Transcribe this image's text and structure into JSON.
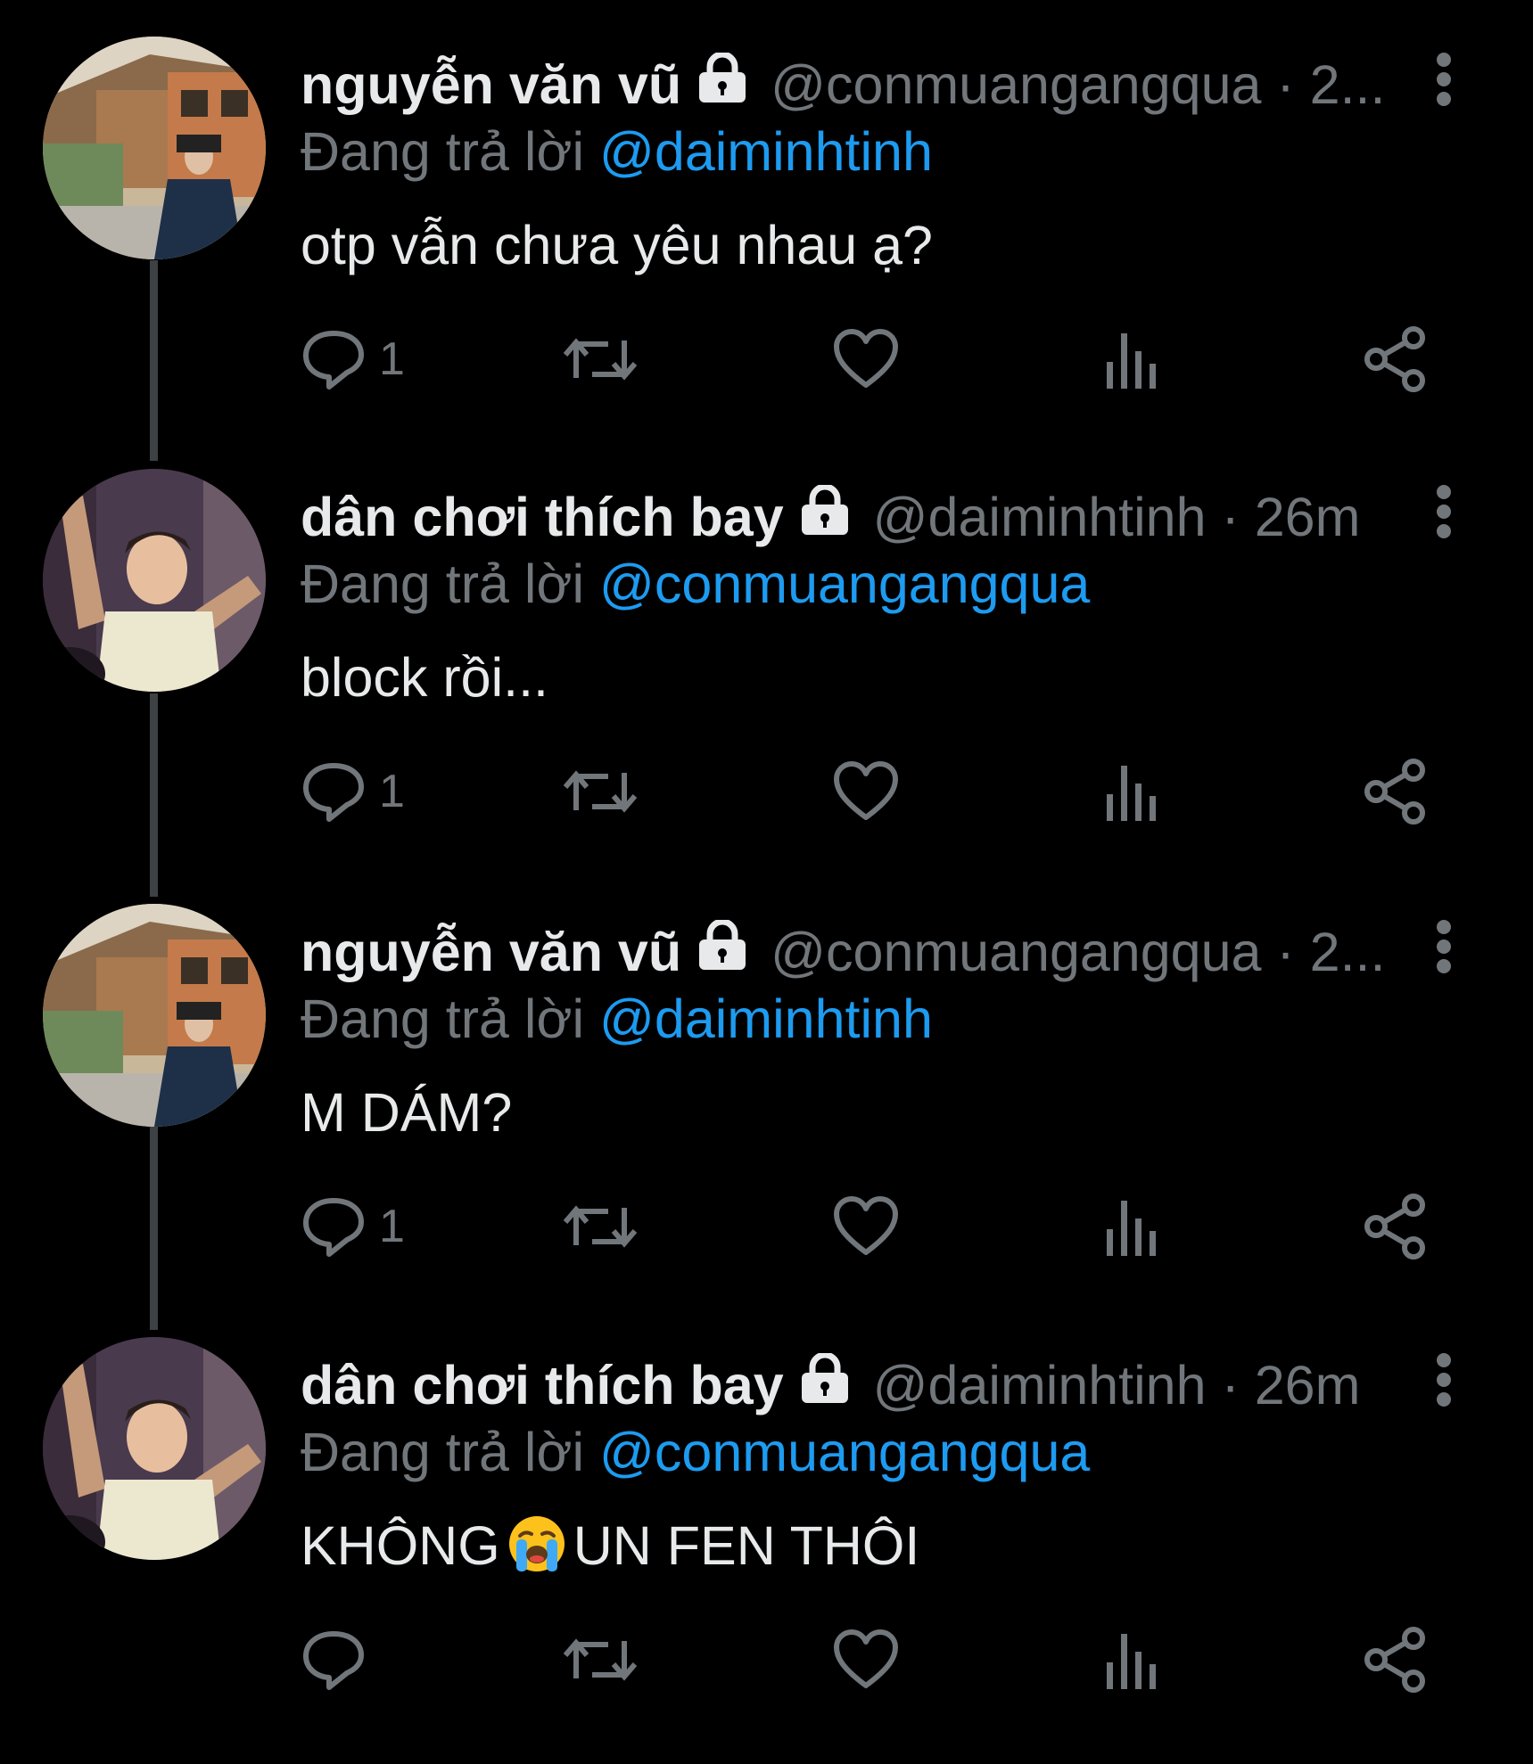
{
  "thread": {
    "tweets": [
      {
        "author": {
          "display_name": "nguyễn văn vũ",
          "handle": "@conmuangangqua",
          "time": "2..."
        },
        "handle_meta": "@conmuangangqua · 2...",
        "reply_prefix": "Đang trả lời",
        "reply_to": "@daiminhtinh",
        "text": "otp vẫn chưa yêu nhau ạ?",
        "reply_count": "1"
      },
      {
        "author": {
          "display_name": "dân chơi thích bay",
          "handle": "@daiminhtinh",
          "time": "26m"
        },
        "handle_meta": "@daiminhtinh · 26m",
        "reply_prefix": "Đang trả lời",
        "reply_to": "@conmuangangqua",
        "text": "block rồi...",
        "reply_count": "1"
      },
      {
        "author": {
          "display_name": "nguyễn văn vũ",
          "handle": "@conmuangangqua",
          "time": "2..."
        },
        "handle_meta": "@conmuangangqua · 2...",
        "reply_prefix": "Đang trả lời",
        "reply_to": "@daiminhtinh",
        "text": "M DÁM?",
        "reply_count": "1"
      },
      {
        "author": {
          "display_name": "dân chơi thích bay",
          "handle": "@daiminhtinh",
          "time": "26m"
        },
        "handle_meta": "@daiminhtinh · 26m",
        "reply_prefix": "Đang trả lời",
        "reply_to": "@conmuangangqua",
        "text_before_emoji": "KHÔNG",
        "emoji": "loudly-crying-face",
        "text_after_emoji": "UN FEN THÔI",
        "reply_count": ""
      }
    ]
  },
  "icons": {
    "lock": "lock-icon",
    "more": "more-vertical-icon",
    "reply": "reply-icon",
    "retweet": "retweet-icon",
    "like": "heart-icon",
    "views": "bar-chart-icon",
    "share": "share-icon"
  },
  "colors": {
    "background": "#000000",
    "text_primary": "#e7e9ea",
    "text_secondary": "#71767b",
    "mention": "#1d9bf0",
    "thread_line": "#3e4144"
  }
}
